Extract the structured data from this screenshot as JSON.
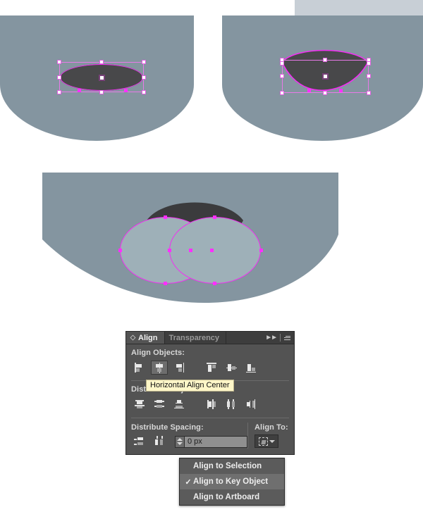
{
  "colors": {
    "artboard_shape": "#8495a0",
    "dark_fill": "#48484a",
    "light_ellipse_fill": "#9eb0b8",
    "selection_magenta": "#f22ef2",
    "panel_bg": "#535353",
    "tooltip_bg": "#fdf6c8",
    "topbar": "#c8cfd6"
  },
  "panel": {
    "tabs": [
      {
        "label": "Align",
        "active": true
      },
      {
        "label": "Transparency",
        "active": false
      }
    ],
    "collapse_icon": "double-chevron-right-icon",
    "menu_icon": "panel-menu-icon",
    "align_objects_label": "Align Objects:",
    "align_objects_buttons": [
      {
        "name": "horizontal-align-left",
        "selected": false
      },
      {
        "name": "horizontal-align-center",
        "selected": true
      },
      {
        "name": "horizontal-align-right",
        "selected": false
      },
      {
        "name": "vertical-align-top",
        "selected": false
      },
      {
        "name": "vertical-align-center",
        "selected": false
      },
      {
        "name": "vertical-align-bottom",
        "selected": false
      }
    ],
    "distribute_objects_label": "Distribute Objects:",
    "distribute_objects_buttons": [
      {
        "name": "vertical-distribute-top",
        "selected": false
      },
      {
        "name": "vertical-distribute-center",
        "selected": false
      },
      {
        "name": "vertical-distribute-bottom",
        "selected": false
      },
      {
        "name": "horizontal-distribute-left",
        "selected": false
      },
      {
        "name": "horizontal-distribute-center",
        "selected": false
      },
      {
        "name": "horizontal-distribute-right",
        "selected": false
      }
    ],
    "distribute_spacing_label": "Distribute Spacing:",
    "distribute_spacing_buttons": [
      {
        "name": "vertical-distribute-spacing",
        "selected": false
      },
      {
        "name": "horizontal-distribute-spacing",
        "selected": false
      }
    ],
    "spacing_value": "0 px",
    "align_to_label": "Align To:",
    "align_to_icon": "align-to-key-object-icon"
  },
  "tooltip": {
    "text": "Horizontal Align Center"
  },
  "dropdown": {
    "items": [
      {
        "label": "Align to Selection",
        "checked": false,
        "highlighted": false
      },
      {
        "label": "Align to Key Object",
        "checked": true,
        "highlighted": true
      },
      {
        "label": "Align to Artboard",
        "checked": false,
        "highlighted": false
      }
    ],
    "check_glyph": "✓"
  },
  "artboards": [
    {
      "name": "artboard-top-left",
      "caption": ""
    },
    {
      "name": "artboard-top-right",
      "caption": ""
    },
    {
      "name": "artboard-bottom",
      "caption": ""
    }
  ]
}
